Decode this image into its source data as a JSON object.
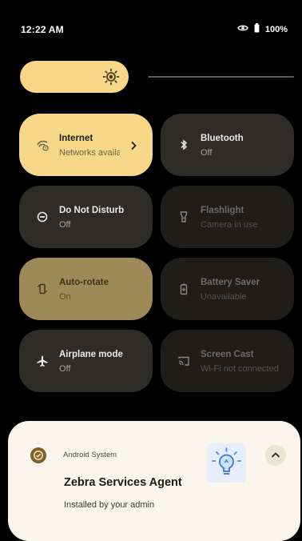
{
  "status_bar": {
    "time": "12:22 AM",
    "battery": "100%"
  },
  "brightness": {
    "level": 0.42
  },
  "tiles": [
    {
      "title": "Internet",
      "subtitle": "Networks available",
      "state": "on",
      "icon": "wifi-icon"
    },
    {
      "title": "Bluetooth",
      "subtitle": "Off",
      "state": "off",
      "icon": "bluetooth-icon"
    },
    {
      "title": "Do Not Disturb",
      "subtitle": "Off",
      "state": "off",
      "icon": "do-not-disturb-icon"
    },
    {
      "title": "Flashlight",
      "subtitle": "Camera in use",
      "state": "unavailable",
      "icon": "flashlight-icon"
    },
    {
      "title": "Auto-rotate",
      "subtitle": "On",
      "state": "on",
      "icon": "auto-rotate-icon"
    },
    {
      "title": "Battery Saver",
      "subtitle": "Unavailable",
      "state": "unavailable",
      "icon": "battery-saver-icon"
    },
    {
      "title": "Airplane mode",
      "subtitle": "Off",
      "state": "off",
      "icon": "airplane-icon"
    },
    {
      "title": "Screen Cast",
      "subtitle": "Wi-Fi not connected",
      "state": "unavailable",
      "icon": "cast-icon"
    }
  ],
  "notification": {
    "app_name": "Android System",
    "title": "Zebra Services Agent",
    "text": "Installed by your admin"
  },
  "colors": {
    "accent": "#f7d889",
    "accent_mid": "#9d8a58",
    "tile_off": "#2e2c27",
    "tile_unavailable": "#1e1d1a",
    "notification_bg": "#fbf6ed"
  }
}
